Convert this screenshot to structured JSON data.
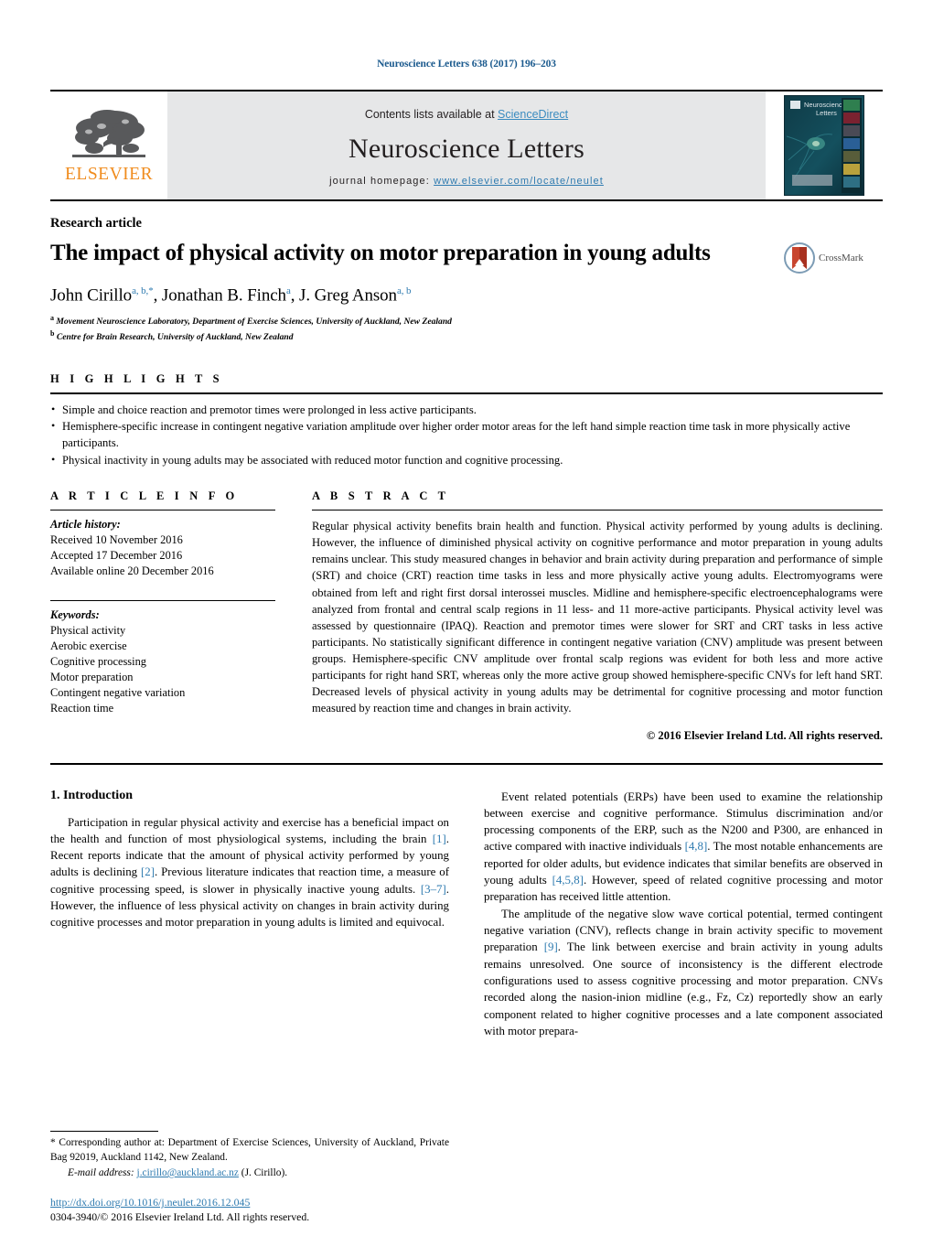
{
  "running_head": "Neuroscience Letters 638 (2017) 196–203",
  "masthead": {
    "contents_prefix": "Contents lists available at ",
    "sciencedirect": "ScienceDirect",
    "journal_name": "Neuroscience Letters",
    "homepage_prefix": "journal homepage: ",
    "homepage_url": "www.elsevier.com/locate/neulet",
    "publisher_logo_text": "ELSEVIER",
    "cover_title_line1": "Neuroscience",
    "cover_title_line2": "Letters",
    "band_color": "#e6e7e8",
    "link_color": "#2f7bb0",
    "elsevier_orange": "#f08c1e"
  },
  "article": {
    "type": "Research article",
    "title": "The impact of physical activity on motor preparation in young adults",
    "crossmark_label": "CrossMark",
    "authors_html": "John Cirillo<sup>a, b,</sup><sup>*</sup>, Jonathan B. Finch<sup>a</sup>, J. Greg Anson<sup>a, b</sup>",
    "affiliations": [
      {
        "marker": "a",
        "text": "Movement Neuroscience Laboratory, Department of Exercise Sciences, University of Auckland, New Zealand"
      },
      {
        "marker": "b",
        "text": "Centre for Brain Research, University of Auckland, New Zealand"
      }
    ]
  },
  "highlights": {
    "heading": "H I G H L I G H T S",
    "items": [
      "Simple and choice reaction and premotor times were prolonged in less active participants.",
      "Hemisphere-specific increase in contingent negative variation amplitude over higher order motor areas for the left hand simple reaction time task in more physically active participants.",
      "Physical inactivity in young adults may be associated with reduced motor function and cognitive processing."
    ]
  },
  "article_info": {
    "heading": "A R T I C L E   I N F O",
    "history_label": "Article history:",
    "history": [
      "Received 10 November 2016",
      "Accepted 17 December 2016",
      "Available online 20 December 2016"
    ],
    "keywords_label": "Keywords:",
    "keywords": [
      "Physical activity",
      "Aerobic exercise",
      "Cognitive processing",
      "Motor preparation",
      "Contingent negative variation",
      "Reaction time"
    ]
  },
  "abstract": {
    "heading": "A B S T R A C T",
    "text": "Regular physical activity benefits brain health and function. Physical activity performed by young adults is declining. However, the influence of diminished physical activity on cognitive performance and motor preparation in young adults remains unclear. This study measured changes in behavior and brain activity during preparation and performance of simple (SRT) and choice (CRT) reaction time tasks in less and more physically active young adults. Electromyograms were obtained from left and right first dorsal interossei muscles. Midline and hemisphere-specific electroencephalograms were analyzed from frontal and central scalp regions in 11 less- and 11 more-active participants. Physical activity level was assessed by questionnaire (IPAQ). Reaction and premotor times were slower for SRT and CRT tasks in less active participants. No statistically significant difference in contingent negative variation (CNV) amplitude was present between groups. Hemisphere-specific CNV amplitude over frontal scalp regions was evident for both less and more active participants for right hand SRT, whereas only the more active group showed hemisphere-specific CNVs for left hand SRT. Decreased levels of physical activity in young adults may be detrimental for cognitive processing and motor function measured by reaction time and changes in brain activity.",
    "copyright": "© 2016 Elsevier Ireland Ltd. All rights reserved."
  },
  "body": {
    "section_heading": "1. Introduction",
    "left_paragraph_html": "Participation in regular physical activity and exercise has a beneficial impact on the health and function of most physiological systems, including the brain <span class=\"ref\">[1]</span>. Recent reports indicate that the amount of physical activity performed by young adults is declining <span class=\"ref\">[2]</span>. Previous literature indicates that reaction time, a measure of cognitive processing speed, is slower in physically inactive young adults. <span class=\"ref\">[3–7]</span>. However, the influence of less physical activity on changes in brain activity during cognitive processes and motor preparation in young adults is limited and equivocal.",
    "right_paragraph_1_html": "Event related potentials (ERPs) have been used to examine the relationship between exercise and cognitive performance. Stimulus discrimination and/or processing components of the ERP, such as the N200 and P300, are enhanced in active compared with inactive individuals <span class=\"ref\">[4,8]</span>. The most notable enhancements are reported for older adults, but evidence indicates that similar benefits are observed in young adults <span class=\"ref\">[4,5,8]</span>. However, speed of related cognitive processing and motor preparation has received little attention.",
    "right_paragraph_2_html": "The amplitude of the negative slow wave cortical potential, termed contingent negative variation (CNV), reflects change in brain activity specific to movement preparation <span class=\"ref\">[9]</span>. The link between exercise and brain activity in young adults remains unresolved. One source of inconsistency is the different electrode configurations used to assess cognitive processing and motor preparation. CNVs recorded along the nasion-inion midline (e.g., Fz, Cz) reportedly show an early component related to higher cognitive processes and a late component associated with motor prepara-"
  },
  "footer": {
    "corresponding_html": "<span class=\"fn-em\"></span>* Corresponding author at: Department of Exercise Sciences, University of Auckland, Private Bag 92019, Auckland 1142, New Zealand.",
    "email_label": "E-mail address:",
    "email": "j.cirillo@auckland.ac.nz",
    "email_suffix": "(J. Cirillo).",
    "doi": "http://dx.doi.org/10.1016/j.neulet.2016.12.045",
    "issn_line": "0304-3940/© 2016 Elsevier Ireland Ltd. All rights reserved."
  }
}
